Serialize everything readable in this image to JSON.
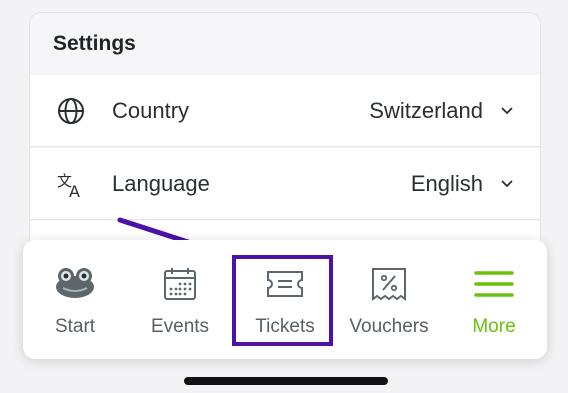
{
  "settings": {
    "header": "Settings",
    "rows": [
      {
        "label": "Country",
        "value": "Switzerland",
        "icon": "globe-icon"
      },
      {
        "label": "Language",
        "value": "English",
        "icon": "translate-icon"
      }
    ]
  },
  "nav": {
    "items": [
      {
        "label": "Start",
        "icon": "frog-icon"
      },
      {
        "label": "Events",
        "icon": "calendar-icon"
      },
      {
        "label": "Tickets",
        "icon": "ticket-icon"
      },
      {
        "label": "Vouchers",
        "icon": "voucher-icon"
      },
      {
        "label": "More",
        "icon": "menu-icon",
        "active": true
      }
    ]
  },
  "colors": {
    "accent": "#6ac00f",
    "highlight": "#4b12a8"
  }
}
